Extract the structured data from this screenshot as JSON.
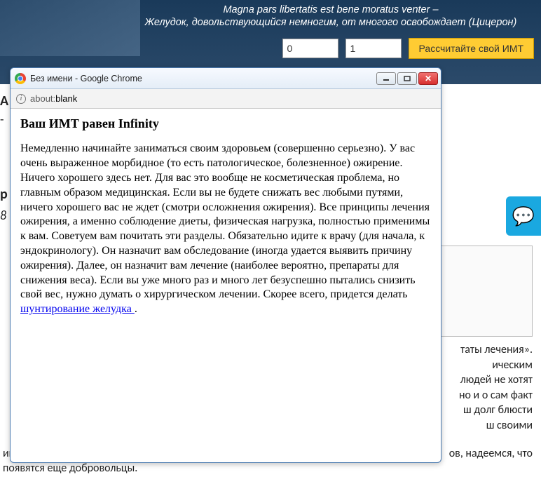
{
  "header": {
    "quote_latin": "Magna pars libertatis est bene moratus venter –",
    "quote_ru": "Желудок, довольствующийся немногим, от многого освобождает (Цицерон)",
    "input1_value": "0",
    "input2_value": "1",
    "bmi_button_label": "Рассчитайте свой ИМТ"
  },
  "background": {
    "side_frag1": "A",
    "side_letter": "-",
    "side_frag2": "р",
    "side_frag3": "8",
    "box_text": "",
    "para1_lines": [
      "таты лечения».",
      "ическим",
      "людей не хотят",
      "но и о сам факт",
      "ш долг блюсти",
      "ш своими"
    ],
    "para2a": "ии",
    "para2b": "ов, надеемся, что",
    "para2c": "появятся еще добровольцы."
  },
  "popup": {
    "window_title": "Без имени - Google Chrome",
    "address_proto": "about:",
    "address_path": "blank",
    "heading_prefix": "Ваш ИМТ равен ",
    "heading_value": "Infinity",
    "body_text": "Немедленно начинайте заниматься своим здоровьем (совершенно серьезно). У вас очень выраженное морбидное (то есть патологическое, болезненное) ожирение. Ничего хорошего здесь нет. Для вас это вообще не косметическая проблема, но главным образом медицинская. Если вы не будете снижать вес любыми путями, ничего хорошего вас не ждет (смотри осложнения ожирения). Все принципы лечения ожирения, а именно соблюдение диеты, физическая нагрузка, полностью применимы к вам. Советуем вам почитать эти разделы. Обязательно идите к врачу (для начала, к эндокринологу). Он назначит вам обследование (иногда удается выявить причину ожирения). Далее, он назначит вам лечение (наиболее вероятно, препараты для снижения веса). Если вы уже много раз и много лет безуспешно пытались снизить свой вес, нужно думать о хирургическом лечении. Скорее всего, придется делать ",
    "link_text": "шунтирование желудка ",
    "body_tail": "."
  }
}
